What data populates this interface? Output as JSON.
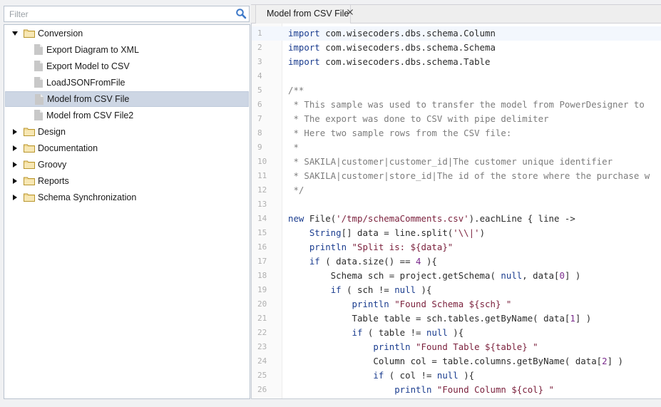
{
  "filter": {
    "placeholder": "Filter",
    "value": ""
  },
  "tree": {
    "items": [
      {
        "label": "Conversion",
        "type": "folder",
        "expanded": true,
        "level": 0
      },
      {
        "label": "Export Diagram to XML",
        "type": "file",
        "level": 1
      },
      {
        "label": "Export Model to CSV",
        "type": "file",
        "level": 1
      },
      {
        "label": "LoadJSONFromFile",
        "type": "file",
        "level": 1
      },
      {
        "label": "Model from CSV File",
        "type": "file",
        "level": 1,
        "selected": true
      },
      {
        "label": "Model from CSV File2",
        "type": "file",
        "level": 1
      },
      {
        "label": "Design",
        "type": "folder",
        "expanded": false,
        "level": 0
      },
      {
        "label": "Documentation",
        "type": "folder",
        "expanded": false,
        "level": 0
      },
      {
        "label": "Groovy",
        "type": "folder",
        "expanded": false,
        "level": 0
      },
      {
        "label": "Reports",
        "type": "folder",
        "expanded": false,
        "level": 0
      },
      {
        "label": "Schema Synchronization",
        "type": "folder",
        "expanded": false,
        "level": 0
      }
    ]
  },
  "tabs": [
    {
      "label": "Model from CSV File",
      "active": true,
      "close_icon": "close-icon"
    }
  ],
  "editor": {
    "current_line": 1,
    "lines": [
      {
        "n": "1",
        "tokens": [
          [
            "kw",
            "import"
          ],
          [
            "",
            " com.wisecoders.dbs.schema.Column"
          ]
        ]
      },
      {
        "n": "2",
        "tokens": [
          [
            "kw",
            "import"
          ],
          [
            "",
            " com.wisecoders.dbs.schema.Schema"
          ]
        ]
      },
      {
        "n": "3",
        "tokens": [
          [
            "kw",
            "import"
          ],
          [
            "",
            " com.wisecoders.dbs.schema.Table"
          ]
        ]
      },
      {
        "n": "4",
        "tokens": []
      },
      {
        "n": "5",
        "tokens": [
          [
            "cm",
            "/**"
          ]
        ]
      },
      {
        "n": "6",
        "tokens": [
          [
            "cm",
            " * This sample was used to transfer the model from PowerDesigner to "
          ]
        ]
      },
      {
        "n": "7",
        "tokens": [
          [
            "cm",
            " * The export was done to CSV with pipe delimiter"
          ]
        ]
      },
      {
        "n": "8",
        "tokens": [
          [
            "cm",
            " * Here two sample rows from the CSV file:"
          ]
        ]
      },
      {
        "n": "9",
        "tokens": [
          [
            "cm",
            " *"
          ]
        ]
      },
      {
        "n": "10",
        "tokens": [
          [
            "cm",
            " * SAKILA|customer|customer_id|The customer unique identifier"
          ]
        ]
      },
      {
        "n": "11",
        "tokens": [
          [
            "cm",
            " * SAKILA|customer|store_id|The id of the store where the purchase w"
          ]
        ]
      },
      {
        "n": "12",
        "tokens": [
          [
            "cm",
            " */"
          ]
        ]
      },
      {
        "n": "13",
        "tokens": []
      },
      {
        "n": "14",
        "tokens": [
          [
            "kw",
            "new"
          ],
          [
            "",
            " File("
          ],
          [
            "str",
            "'/tmp/schemaComments.csv'"
          ],
          [
            "",
            ").eachLine { line ->"
          ]
        ]
      },
      {
        "n": "15",
        "tokens": [
          [
            "",
            "    "
          ],
          [
            "kw",
            "String"
          ],
          [
            "",
            "[] data = line.split("
          ],
          [
            "str",
            "'\\\\|'"
          ],
          [
            "",
            ")"
          ]
        ]
      },
      {
        "n": "16",
        "tokens": [
          [
            "",
            "    "
          ],
          [
            "kw",
            "println"
          ],
          [
            "",
            " "
          ],
          [
            "str",
            "\"Split is: ${data}\""
          ]
        ]
      },
      {
        "n": "17",
        "tokens": [
          [
            "",
            "    "
          ],
          [
            "kw",
            "if"
          ],
          [
            "",
            " ( data.size() == "
          ],
          [
            "num",
            "4"
          ],
          [
            "",
            " ){"
          ]
        ]
      },
      {
        "n": "18",
        "tokens": [
          [
            "",
            "        Schema sch = project.getSchema( "
          ],
          [
            "kw",
            "null"
          ],
          [
            "",
            ", data["
          ],
          [
            "num",
            "0"
          ],
          [
            "",
            "] )"
          ]
        ]
      },
      {
        "n": "19",
        "tokens": [
          [
            "",
            "        "
          ],
          [
            "kw",
            "if"
          ],
          [
            "",
            " ( sch != "
          ],
          [
            "kw",
            "null"
          ],
          [
            "",
            " ){"
          ]
        ]
      },
      {
        "n": "20",
        "tokens": [
          [
            "",
            "            "
          ],
          [
            "kw",
            "println"
          ],
          [
            "",
            " "
          ],
          [
            "str",
            "\"Found Schema ${sch} \""
          ]
        ]
      },
      {
        "n": "21",
        "tokens": [
          [
            "",
            "            Table table = sch.tables.getByName( data["
          ],
          [
            "num",
            "1"
          ],
          [
            "",
            "] )"
          ]
        ]
      },
      {
        "n": "22",
        "tokens": [
          [
            "",
            "            "
          ],
          [
            "kw",
            "if"
          ],
          [
            "",
            " ( table != "
          ],
          [
            "kw",
            "null"
          ],
          [
            "",
            " ){"
          ]
        ]
      },
      {
        "n": "23",
        "tokens": [
          [
            "",
            "                "
          ],
          [
            "kw",
            "println"
          ],
          [
            "",
            " "
          ],
          [
            "str",
            "\"Found Table ${table} \""
          ]
        ]
      },
      {
        "n": "24",
        "tokens": [
          [
            "",
            "                Column col = table.columns.getByName( data["
          ],
          [
            "num",
            "2"
          ],
          [
            "",
            "] )"
          ]
        ]
      },
      {
        "n": "25",
        "tokens": [
          [
            "",
            "                "
          ],
          [
            "kw",
            "if"
          ],
          [
            "",
            " ( col != "
          ],
          [
            "kw",
            "null"
          ],
          [
            "",
            " ){"
          ]
        ]
      },
      {
        "n": "26",
        "tokens": [
          [
            "",
            "                    "
          ],
          [
            "kw",
            "println"
          ],
          [
            "",
            " "
          ],
          [
            "str",
            "\"Found Column ${col} \""
          ]
        ]
      }
    ]
  },
  "colors": {
    "selection": "#cdd6e4",
    "keyword": "#1b3d8f",
    "string": "#7a1f3b",
    "comment": "#7c7c7c",
    "number": "#7a2a8c",
    "folder": "#e8c872"
  }
}
